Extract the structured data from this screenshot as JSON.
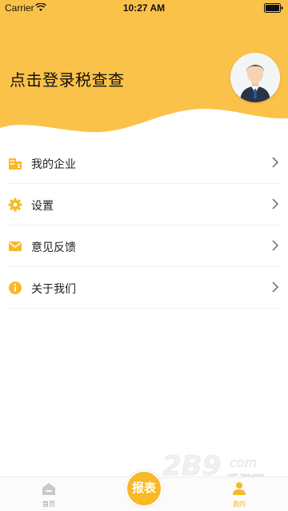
{
  "status_bar": {
    "carrier": "Carrier",
    "time": "10:27 AM"
  },
  "header": {
    "login_text": "点击登录税查查",
    "background_color": "#fbc24a"
  },
  "menu": {
    "items": [
      {
        "label": "我的企业",
        "icon": "building-icon"
      },
      {
        "label": "设置",
        "icon": "gear-icon"
      },
      {
        "label": "意见反馈",
        "icon": "envelope-icon"
      },
      {
        "label": "关于我们",
        "icon": "info-icon"
      }
    ]
  },
  "tabbar": {
    "home_label": "首页",
    "report_label": "报表",
    "mine_label": "我的",
    "accent_color": "#f7b928"
  },
  "watermark": {
    "brand": "2B9",
    "suffix": "com",
    "caption": "手游网"
  }
}
